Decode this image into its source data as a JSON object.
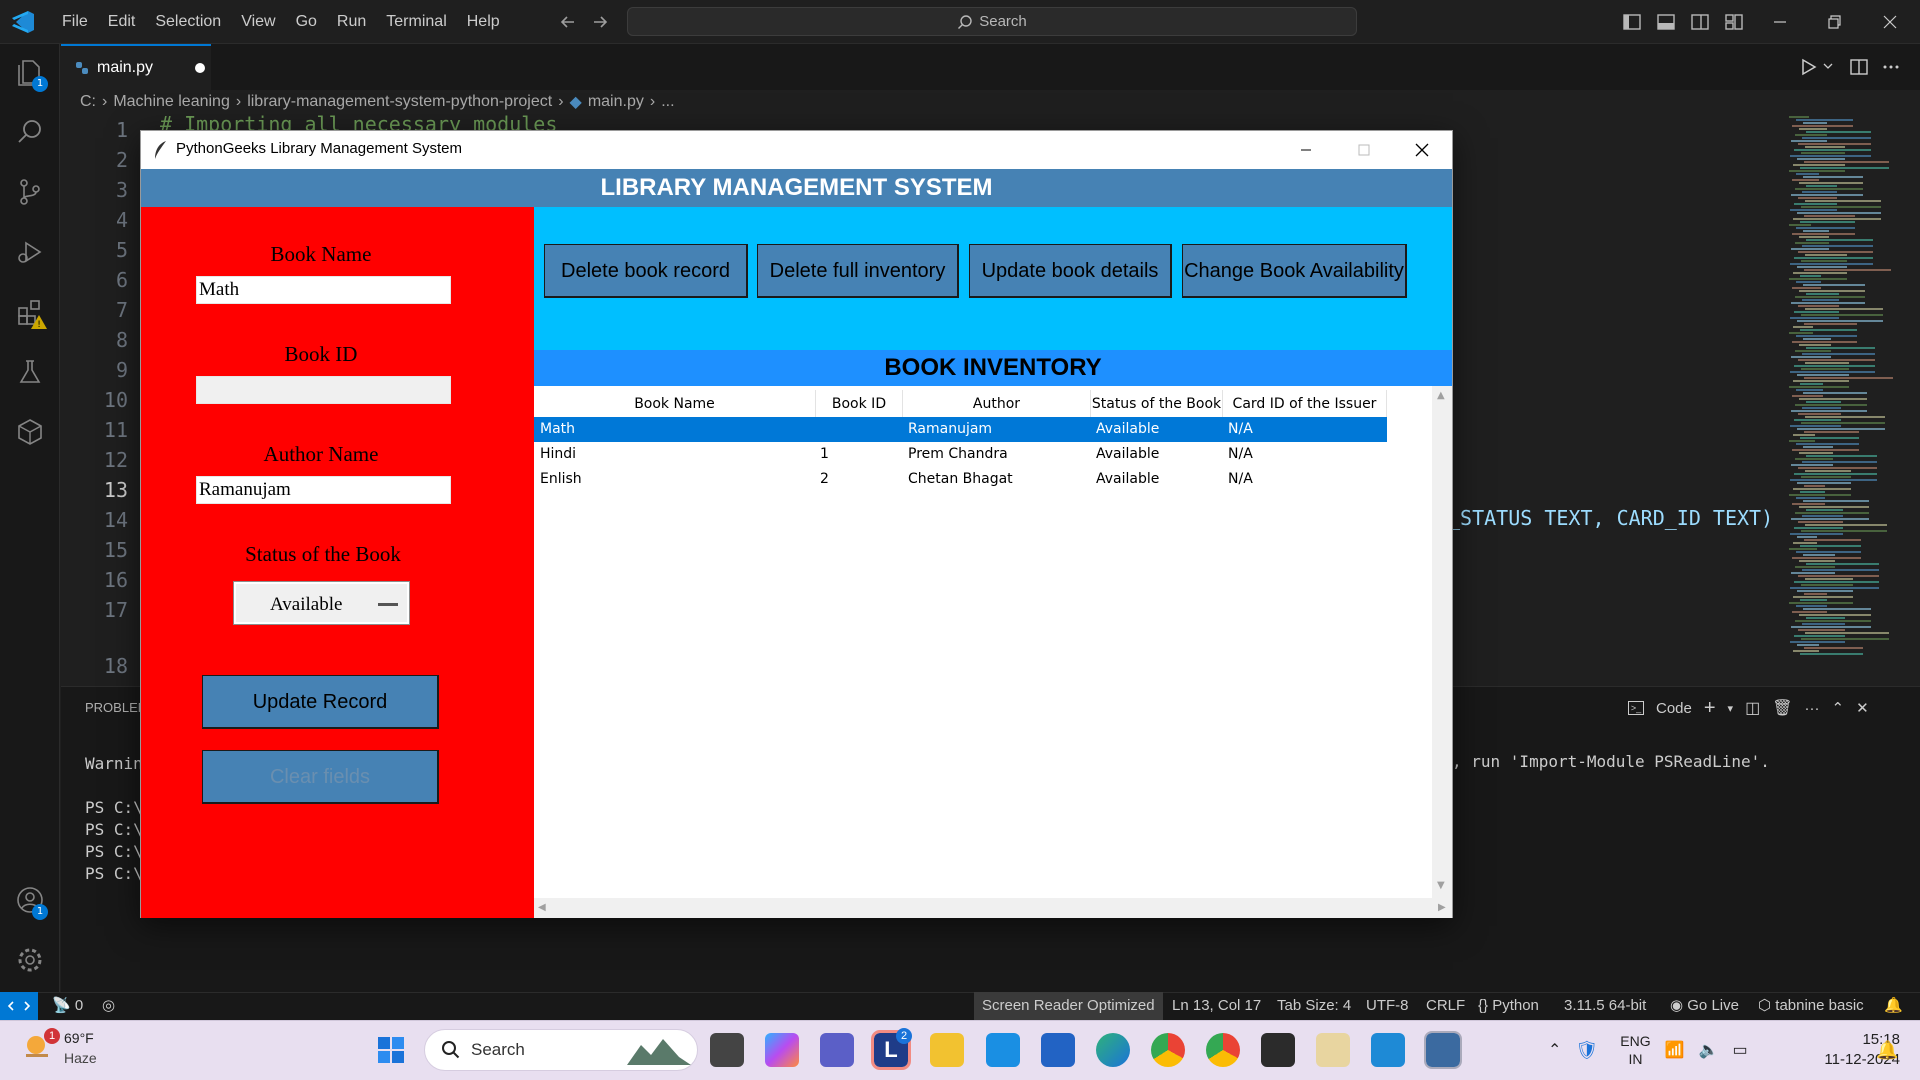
{
  "vscode": {
    "menu": [
      "File",
      "Edit",
      "Selection",
      "View",
      "Go",
      "Run",
      "Terminal",
      "Help"
    ],
    "search_placeholder": "Search",
    "tab_label": "main.py",
    "breadcrumb": [
      "C:",
      "Machine leaning",
      "library-management-system-python-project",
      "main.py",
      "..."
    ],
    "line_numbers": [
      "1",
      "2",
      "3",
      "4",
      "5",
      "6",
      "7",
      "8",
      "9",
      "10",
      "11",
      "12",
      "13",
      "14",
      "15",
      "16",
      "17",
      "18"
    ],
    "code_fragment_line1": "# Importing all necessary modules",
    "code_fragment_right": "_STATUS TEXT, CARD_ID TEXT)",
    "explorer_badge": "1",
    "accounts_badge": "1",
    "panel_title": "PROBLEM",
    "terminal_lines": [
      "Warnin",
      "PS C:\\",
      "PS C:\\",
      "PS C:\\",
      "PS C:\\"
    ],
    "terminal_right": ", run 'Import-Module PSReadLine'.",
    "panel_tool_code": "Code"
  },
  "statusbar": {
    "ports": "0",
    "screen_reader": "Screen Reader Optimized",
    "cursor": "Ln 13, Col 17",
    "tab_size": "Tab Size: 4",
    "encoding": "UTF-8",
    "eol": "CRLF",
    "language": "Python",
    "interpreter": "3.11.5 64-bit",
    "go_live": "Go Live",
    "tabnine": "tabnine basic"
  },
  "app": {
    "window_title": "PythonGeeks Library Management System",
    "header": "LIBRARY MANAGEMENT SYSTEM",
    "form": {
      "book_name_label": "Book Name",
      "book_name_value": "Math",
      "book_id_label": "Book ID",
      "book_id_value": "",
      "author_label": "Author Name",
      "author_value": "Ramanujam",
      "status_label": "Status of the Book",
      "status_value": "Available",
      "update_button": "Update Record",
      "clear_button": "Clear fields"
    },
    "actions": [
      "Delete book record",
      "Delete full inventory",
      "Update book details",
      "Change Book Availability"
    ],
    "inventory_title": "BOOK INVENTORY",
    "table": {
      "columns": [
        "Book Name",
        "Book ID",
        "Author",
        "Status of the Book",
        "Card ID of the Issuer"
      ],
      "rows": [
        [
          "Math",
          "",
          "Ramanujam",
          "Available",
          "N/A"
        ],
        [
          "Hindi",
          "1",
          "Prem Chandra",
          "Available",
          "N/A"
        ],
        [
          "Enlish",
          "2",
          "Chetan Bhagat",
          "Available",
          "N/A"
        ]
      ],
      "selected_row": 0
    },
    "colors": {
      "header_bg": "#4682b4",
      "left_panel": "#ff0000",
      "top_panel": "#00bfff",
      "inventory_header": "#1e90ff",
      "selection": "#0078d7"
    }
  },
  "taskbar": {
    "weather_temp": "69°F",
    "weather_desc": "Haze",
    "weather_badge": "1",
    "search_placeholder": "Search",
    "l_badge": "2",
    "lang_top": "ENG",
    "lang_bottom": "IN",
    "time": "15:18",
    "date": "11-12-2024"
  }
}
